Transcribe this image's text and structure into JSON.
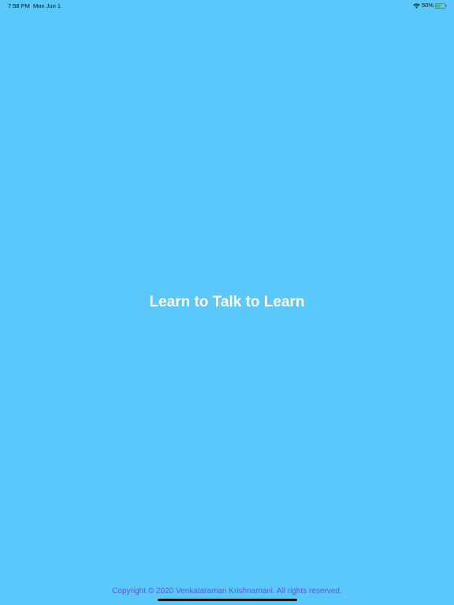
{
  "status_bar": {
    "time": "7:58 PM",
    "date": "Mon Jun 1",
    "battery_percent": "50%",
    "battery_level": 0.5,
    "icons": [
      "wifi-icon",
      "battery-icon"
    ]
  },
  "app": {
    "title": "Learn to Talk to Learn",
    "copyright": "Copyright © 2020 Venkataraman Krishnamani. All rights reserved."
  },
  "colors": {
    "background": "#5ac8fa",
    "title_text": "#ffffff",
    "copyright_text": "#5856d6",
    "battery_fill": "#34c759"
  }
}
